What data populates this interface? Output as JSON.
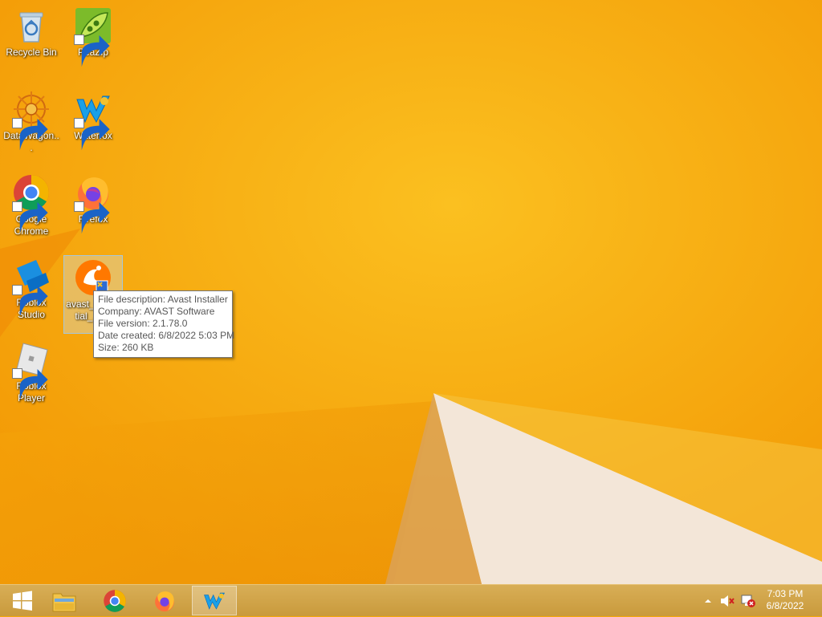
{
  "desktop": {
    "icons": [
      {
        "label": "Recycle Bin",
        "icon": "recycle-bin-icon",
        "shortcut": false
      },
      {
        "label": "PeaZip",
        "icon": "peazip-icon",
        "shortcut": true
      },
      {
        "label": "DataWagon...",
        "icon": "datawagon-icon",
        "shortcut": true
      },
      {
        "label": "Waterfox",
        "icon": "waterfox-icon",
        "shortcut": true
      },
      {
        "label": "Google Chrome",
        "icon": "chrome-icon",
        "shortcut": true
      },
      {
        "label": "Firefox",
        "icon": "firefox-icon",
        "shortcut": true
      },
      {
        "label": "Roblox Studio",
        "icon": "roblox-studio-icon",
        "shortcut": true
      },
      {
        "label": "avast_essential_...on",
        "icon": "avast-installer-icon",
        "shortcut": false,
        "selected": true
      },
      {
        "label": "Roblox Player",
        "icon": "roblox-player-icon",
        "shortcut": true
      }
    ]
  },
  "tooltip": {
    "description": "File description: Avast Installer",
    "company": "Company: AVAST Software",
    "version": "File version: 2.1.78.0",
    "created": "Date created: 6/8/2022 5:03 PM",
    "size": "Size: 260 KB"
  },
  "taskbar": {
    "start": "windows-start-icon",
    "pinned": [
      "file-explorer-icon",
      "chrome-icon",
      "firefox-icon",
      "waterfox-icon"
    ],
    "active": "waterfox-icon"
  },
  "tray": {
    "icons": [
      "show-hidden-icons-chevron",
      "volume-muted-icon",
      "network-error-icon"
    ]
  },
  "clock": {
    "time": "7:03 PM",
    "date": "6/8/2022"
  },
  "colors": {
    "wallpaper": "#f7a90a",
    "taskbar": "#d1a449",
    "accent_light": "#f4e7da"
  }
}
